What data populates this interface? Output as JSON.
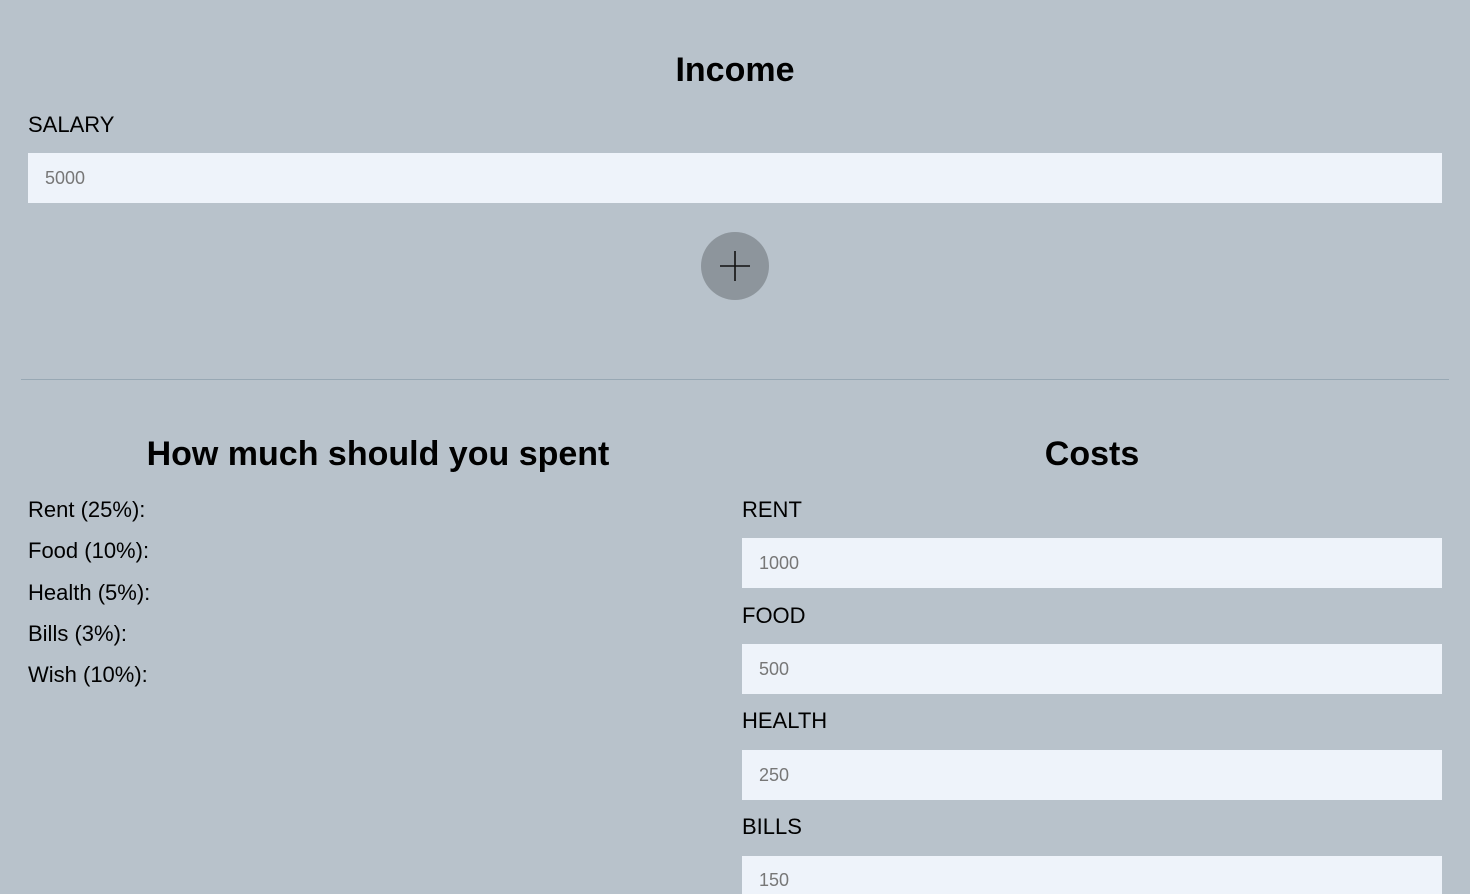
{
  "income": {
    "title": "Income",
    "salary_label": "SALARY",
    "salary_placeholder": "5000",
    "add_button_icon": "plus-icon"
  },
  "spend": {
    "title": "How much should you spent",
    "items": [
      {
        "label": "Rent (25%):"
      },
      {
        "label": "Food (10%):"
      },
      {
        "label": "Health (5%):"
      },
      {
        "label": "Bills (3%):"
      },
      {
        "label": "Wish (10%):"
      }
    ]
  },
  "costs": {
    "title": "Costs",
    "fields": [
      {
        "label": "RENT",
        "placeholder": "1000"
      },
      {
        "label": "FOOD",
        "placeholder": "500"
      },
      {
        "label": "HEALTH",
        "placeholder": "250"
      },
      {
        "label": "BILLS",
        "placeholder": "150"
      }
    ]
  },
  "colors": {
    "background": "#b8c2cb",
    "input_background": "#eef3fa",
    "button_background": "#8d959c"
  }
}
